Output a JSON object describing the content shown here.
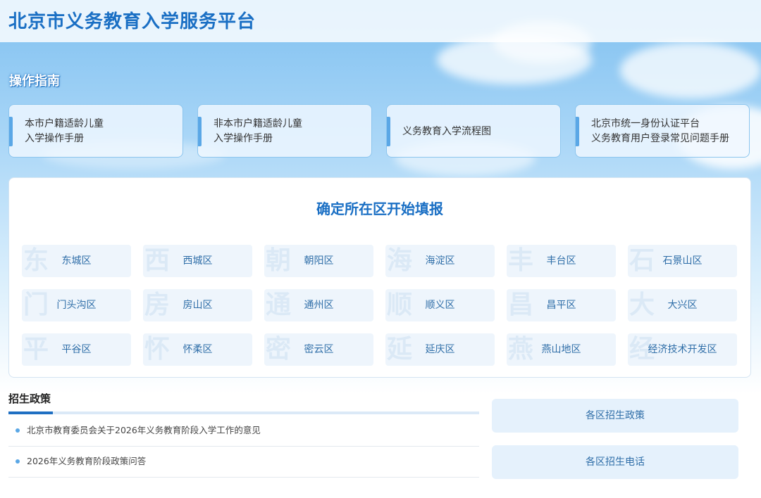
{
  "header": {
    "title": "北京市义务教育入学服务平台"
  },
  "guide": {
    "heading": "操作指南",
    "cards": [
      {
        "line1": "本市户籍适龄儿童",
        "line2": "入学操作手册"
      },
      {
        "line1": "非本市户籍适龄儿童",
        "line2": "入学操作手册"
      },
      {
        "line1": "义务教育入学流程图",
        "line2": ""
      },
      {
        "line1": "北京市统一身份认证平台",
        "line2": "义务教育用户登录常见问题手册"
      }
    ]
  },
  "districts": {
    "title": "确定所在区开始填报",
    "items": [
      {
        "label": "东城区",
        "watermark": "东"
      },
      {
        "label": "西城区",
        "watermark": "西"
      },
      {
        "label": "朝阳区",
        "watermark": "朝"
      },
      {
        "label": "海淀区",
        "watermark": "海"
      },
      {
        "label": "丰台区",
        "watermark": "丰"
      },
      {
        "label": "石景山区",
        "watermark": "石"
      },
      {
        "label": "门头沟区",
        "watermark": "门"
      },
      {
        "label": "房山区",
        "watermark": "房"
      },
      {
        "label": "通州区",
        "watermark": "通"
      },
      {
        "label": "顺义区",
        "watermark": "顺"
      },
      {
        "label": "昌平区",
        "watermark": "昌"
      },
      {
        "label": "大兴区",
        "watermark": "大"
      },
      {
        "label": "平谷区",
        "watermark": "平"
      },
      {
        "label": "怀柔区",
        "watermark": "怀"
      },
      {
        "label": "密云区",
        "watermark": "密"
      },
      {
        "label": "延庆区",
        "watermark": "延"
      },
      {
        "label": "燕山地区",
        "watermark": "燕"
      },
      {
        "label": "经济技术开发区",
        "watermark": "经"
      }
    ]
  },
  "policy": {
    "heading": "招生政策",
    "items": [
      "北京市教育委员会关于2026年义务教育阶段入学工作的意见",
      "2026年义务教育阶段政策问答"
    ]
  },
  "side": {
    "district_policy": "各区招生政策",
    "district_phone": "各区招生电话"
  },
  "colors": {
    "accent": "#1a6fc4",
    "sky": "#7fc0f0"
  }
}
